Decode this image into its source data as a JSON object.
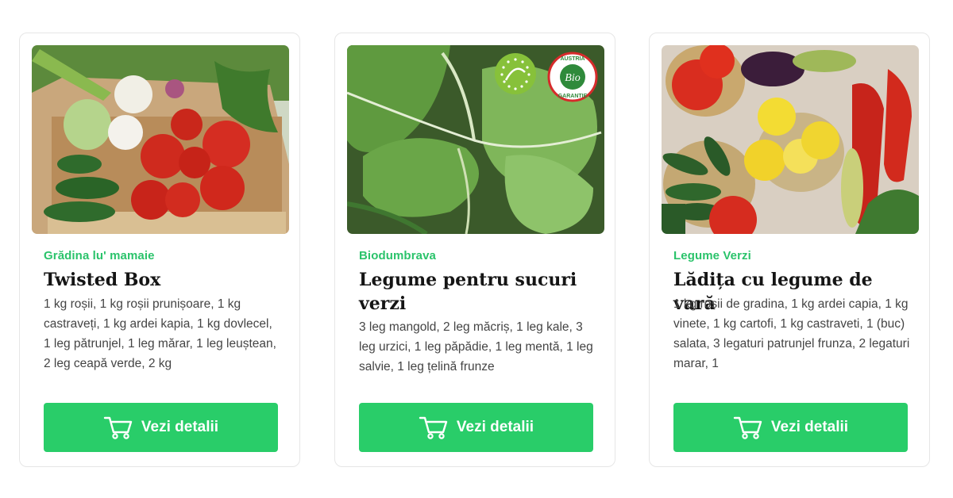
{
  "products": [
    {
      "seller": "Grădina lu' mamaie",
      "title": "Twisted Box",
      "description": "1 kg roșii, 1 kg roșii prunișoare, 1 kg castraveți, 1 kg ardei kapia, 1 kg dovlecel, 1 leg pătrunjel, 1 leg mărar, 1 leg leuștean, 2 leg ceapă verde, 2 kg",
      "button_label": "Vezi detalii",
      "button_icon": "cart-icon",
      "image_icon": "vegetable-box-photo"
    },
    {
      "seller": "Biodumbrava",
      "title": "Legume pentru sucuri verzi",
      "description": "3 leg mangold, 2 leg măcriș, 1 leg kale, 3 leg urzici, 1 leg păpădie, 1 leg mentă, 1 leg salvie, 1 leg țelină frunze",
      "button_label": "Vezi detalii",
      "button_icon": "cart-icon",
      "image_icon": "chard-leaves-photo",
      "badges": [
        "eu-organic-leaf-badge",
        "austria-bio-garantie-badge"
      ],
      "badge_text": {
        "top": "AUSTRIA",
        "center": "Bio",
        "bottom": "GARANTIE"
      }
    },
    {
      "seller": "Legume Verzi",
      "title": "Lădița cu legume de vară",
      "description": "1 kg rosii de gradina, 1 kg ardei capia, 1 kg vinete, 1 kg cartofi, 1 kg castraveti, 1 (buc) salata, 3 legaturi patrunjel frunza, 2 legaturi marar, 1",
      "button_label": "Vezi detalii",
      "button_icon": "cart-icon",
      "image_icon": "summer-vegetables-photo"
    }
  ],
  "colors": {
    "accent": "#29cd69",
    "seller": "#2bc36b",
    "title": "#151515",
    "text": "#444444",
    "border": "#e6e6e6"
  }
}
